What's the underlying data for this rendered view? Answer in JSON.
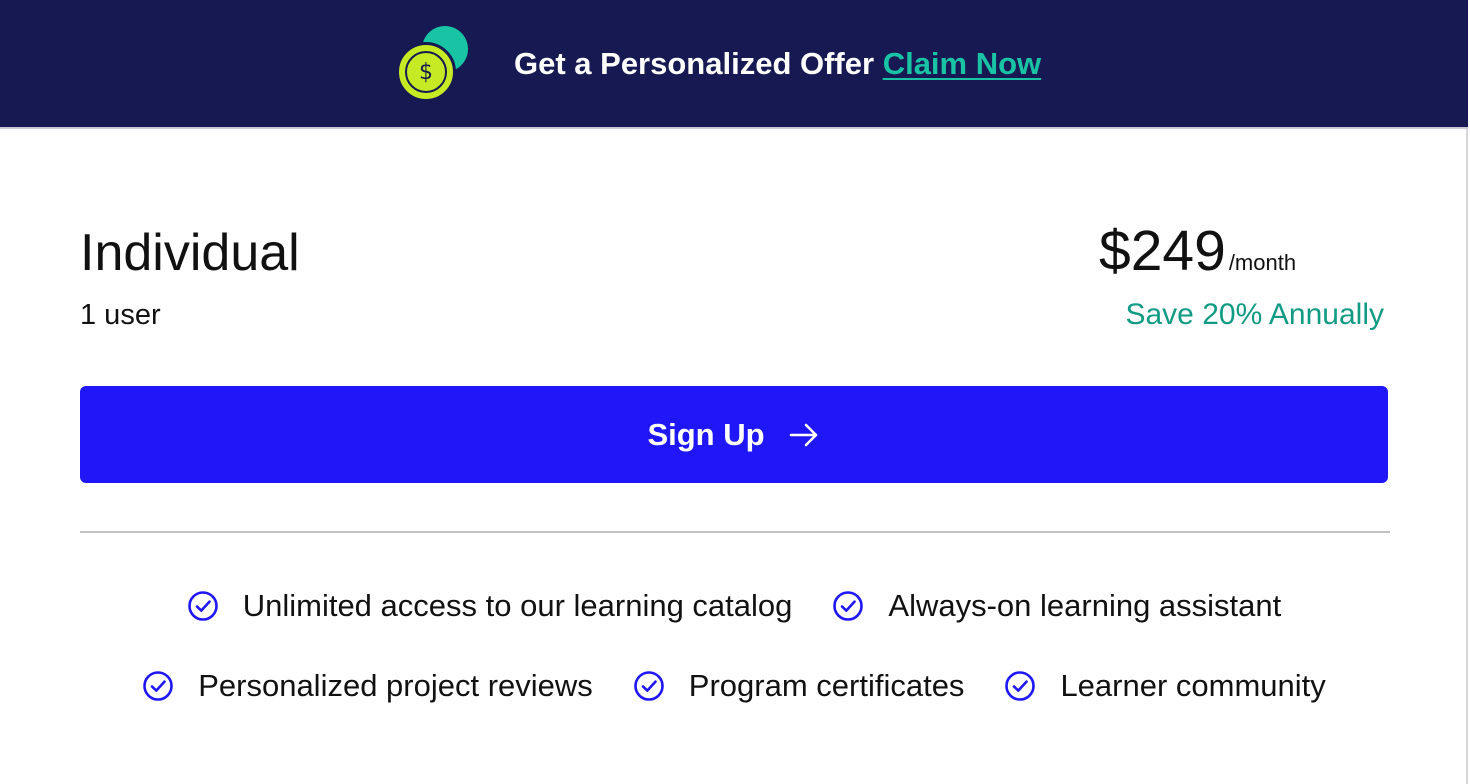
{
  "banner": {
    "text": "Get a Personalized Offer",
    "link_label": "Claim Now",
    "coin_symbol": "$",
    "icon": "dollar-coin-icon",
    "colors": {
      "background": "#171a52",
      "link": "#19c4a5",
      "coin": "#c6ea23",
      "coin_back": "#19c4a5"
    }
  },
  "plan": {
    "name": "Individual",
    "users": "1 user",
    "price": "$249",
    "price_unit": "/month",
    "savings": "Save 20% Annually"
  },
  "cta": {
    "label": "Sign Up",
    "icon": "arrow-right-icon",
    "color": "#1f17f7"
  },
  "features": {
    "icon": "check-circle-icon",
    "row1": [
      "Unlimited access to our learning catalog",
      "Always-on learning assistant"
    ],
    "row2": [
      "Personalized project reviews",
      "Program certificates",
      "Learner community"
    ]
  },
  "colors": {
    "accent": "#1f17f7",
    "savings": "#129b84"
  }
}
